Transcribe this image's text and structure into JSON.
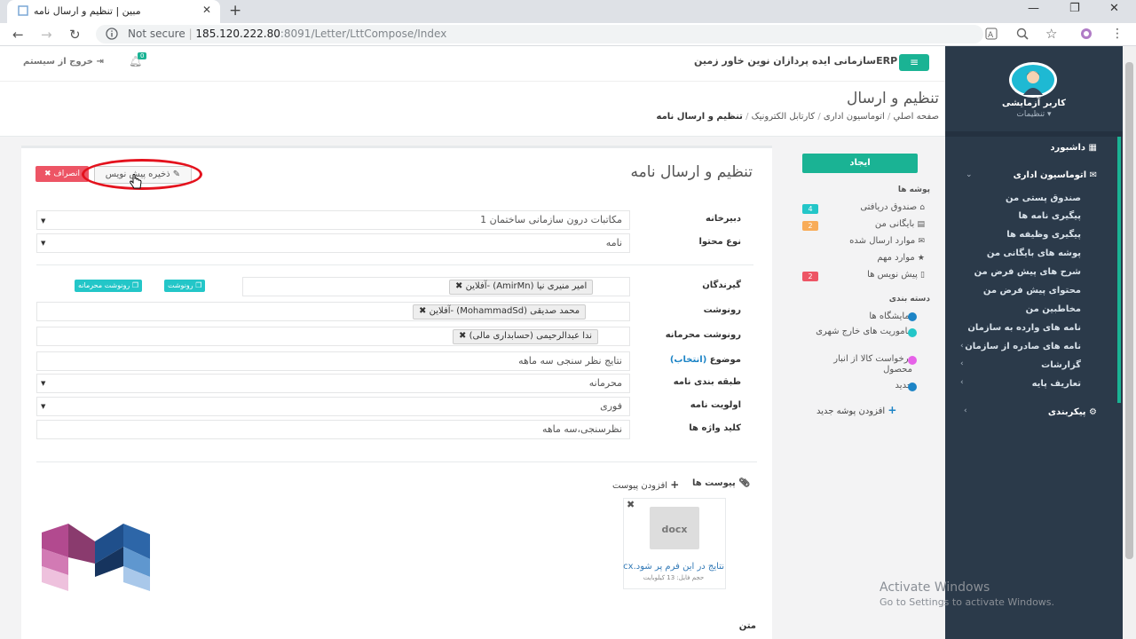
{
  "browser": {
    "tab_title": "مبین | تنظیم و ارسال نامه",
    "security": "Not secure",
    "url_host": "185.120.222.80",
    "url_path": ":8091/Letter/LttCompose/Index"
  },
  "header": {
    "brand": "ERPسازمانی ایده پردازان نوین خاور زمین",
    "logout": "خروج از سیستم",
    "notif_count": "0"
  },
  "user": {
    "name": "کاربر آزمایشی",
    "settings": "تنظیمات"
  },
  "sidebar": {
    "dashboard": "داشبورد",
    "office": "اتوماسیون اداری",
    "items": [
      "صندوق پستی من",
      "پیگیری نامه ها",
      "پیگیری وظیفه ها",
      "پوشه های بایگانی من",
      "شرح های پیش فرض من",
      "محتوای پیش فرض من",
      "مخاطبین من",
      "نامه های وارده به سازمان",
      "نامه های صادره از سازمان",
      "گزارشات",
      "تعاریف پایه"
    ],
    "config": "پیکربندی"
  },
  "page": {
    "title": "تنظیم و ارسال",
    "breadcrumb": [
      "صفحه اصلي",
      "اتوماسیون اداری",
      "کارتابل الکترونیک",
      "تنظیم و ارسال نامه"
    ]
  },
  "folders": {
    "create": "ایجاد",
    "heading": "پوشه ها",
    "items": [
      {
        "label": "صندوق دریافتی",
        "badge": "4",
        "color": "#23c6c8"
      },
      {
        "label": "بایگانی من",
        "badge": "2",
        "color": "#f8ac59"
      },
      {
        "label": "موارد ارسال شده",
        "badge": ""
      },
      {
        "label": "موارد مهم",
        "badge": ""
      },
      {
        "label": "پیش نویس ها",
        "badge": "2",
        "color": "#ed5565"
      }
    ],
    "categories_heading": "دسته بندی",
    "categories": [
      {
        "label": "نمایشگاه ها",
        "color": "#1c84c6"
      },
      {
        "label": "ماموریت های خارج شهری",
        "color": "#23c6c8"
      },
      {
        "label": "درخواست کالا از انبار محصول",
        "color": "#e661e8"
      },
      {
        "label": "جدید",
        "color": "#1c84c6"
      }
    ],
    "add_folder": "افزودن پوشه جدید"
  },
  "form": {
    "title": "تنظیم و ارسال نامه",
    "save_draft": "ذخیره پیش نویس",
    "cancel": "انصراف",
    "secretariat_label": "دبیرخانه",
    "secretariat_value": "مکاتبات درون سازمانی ساختمان 1",
    "content_type_label": "نوع محتوا",
    "content_type_value": "نامه",
    "recipients_label": "گیرندگان",
    "recipient_tag": "امیر منیری نیا (AmirMn) -آفلاین",
    "cc_label": "رونوشت",
    "cc_tag": "محمد صدیقی (MohammadSd) -آفلاین",
    "bcc_label": "رونوشت محرمانه",
    "bcc_tag": "ندا عبدالرحیمی (حسابداری مالی)",
    "cc_btn": "رونوشت",
    "bcc_btn": "رونوشت محرمانه",
    "subject_label": "موضوع",
    "subject_pick": "(انتخاب)",
    "subject_value": "نتایج نظر سنجی سه ماهه",
    "classification_label": "طبقه بندی نامه",
    "classification_value": "محرمانه",
    "priority_label": "اولویت نامه",
    "priority_value": "فوری",
    "keywords_label": "کلید واژه ها",
    "keywords_value": "نظرسنجی،سه ماهه",
    "attachments_label": "پیوست ها",
    "add_attachment": "افزودن پیوست",
    "file_ext": "docx",
    "file_name": "نتایج در این فرم پر شود.docx",
    "file_size": "حجم فایل: 13 کیلوبایت",
    "body_label": "متن"
  },
  "watermark": {
    "line1": "Activate Windows",
    "line2": "Go to Settings to activate Windows."
  },
  "colors": {
    "accent": "#1ab394",
    "sidebar": "#2b3a4a",
    "danger": "#ed5565"
  }
}
